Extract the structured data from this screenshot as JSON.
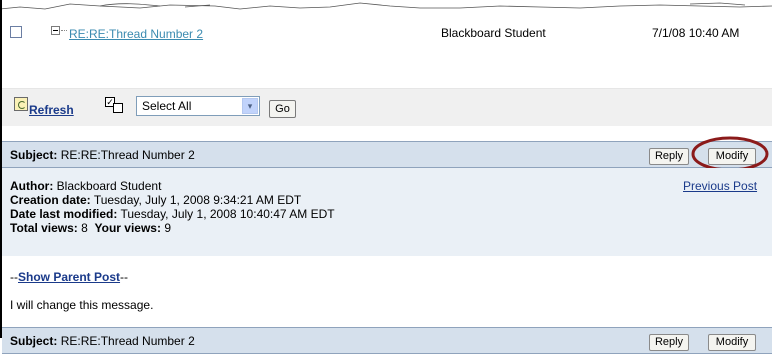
{
  "thread_row": {
    "title": "RE:RE:Thread Number 2",
    "author": "Blackboard Student",
    "date": "7/1/08 10:40 AM"
  },
  "toolbar": {
    "refresh_label": "Refresh",
    "select_value": "Select All",
    "select_arrow": "▾",
    "go_label": "Go"
  },
  "post": {
    "subject_label": "Subject:",
    "subject": "RE:RE:Thread Number 2",
    "reply_label": "Reply",
    "modify_label": "Modify",
    "author_label": "Author:",
    "author": "Blackboard Student",
    "creation_label": "Creation date:",
    "creation_date": "Tuesday, July 1, 2008 9:34:21 AM EDT",
    "modified_label": "Date last modified:",
    "modified_date": "Tuesday, July 1, 2008 10:40:47 AM EDT",
    "total_views_label": "Total views:",
    "total_views": "8",
    "your_views_label": "Your views:",
    "your_views": "9",
    "previous_post_label": "Previous Post",
    "parent_prefix": "--",
    "parent_link": "Show Parent Post",
    "parent_suffix": "--",
    "message": "I will change this message."
  },
  "next_post": {
    "subject_label": "Subject:",
    "subject": "RE:RE:Thread Number 2",
    "reply_label": "Reply",
    "modify_label": "Modify"
  },
  "colors": {
    "subject_bar": "#d5e0ec",
    "info_panel": "#eaf0f6",
    "highlight": "#8b1a1a",
    "link": "#1a3a8a"
  }
}
